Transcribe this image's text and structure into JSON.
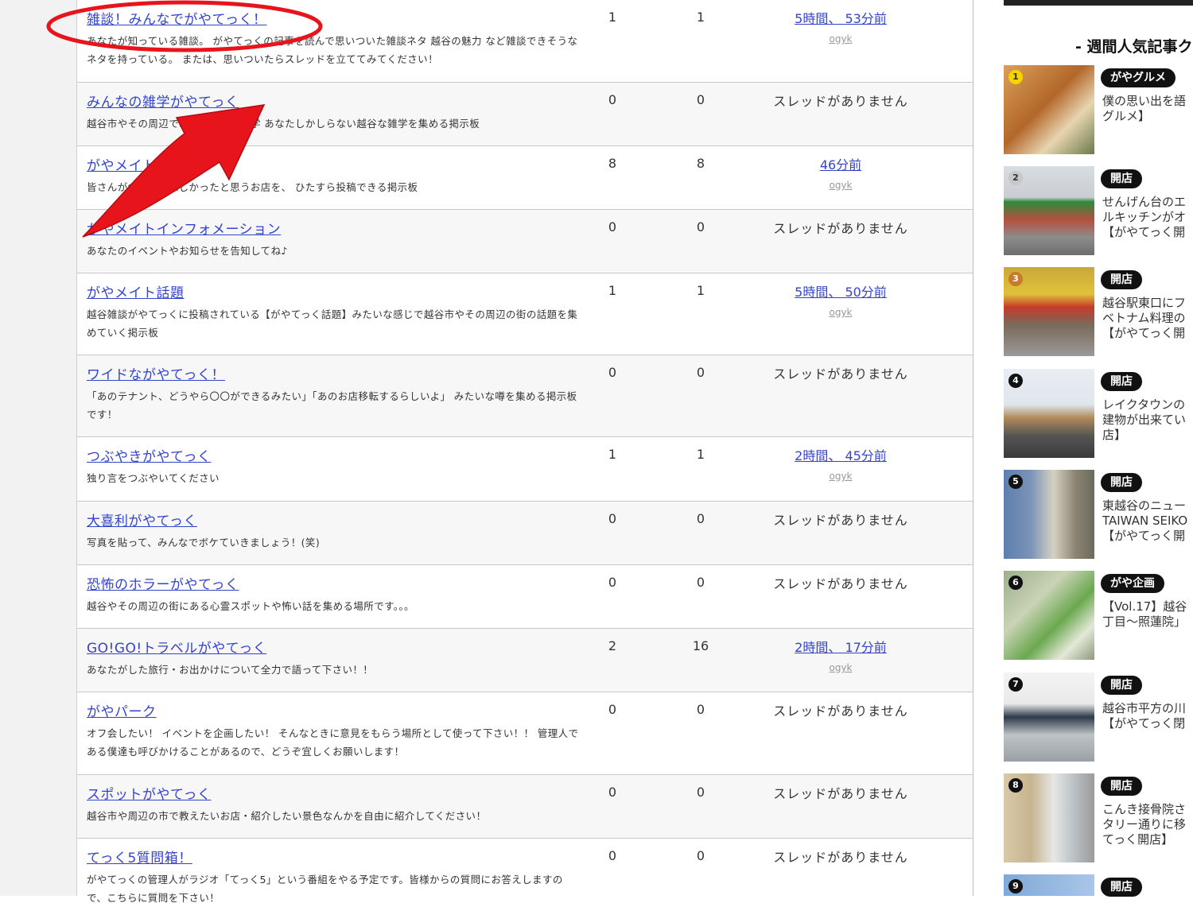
{
  "boards": [
    {
      "title": "雑談！みんなでがやてっく！",
      "desc": "あなたが知っている雑談。 がやてっくの記事を読んで思いついた雑談ネタ 越谷の魅力 など雑談できそうなネタを持っている。 または、思いついたらスレッドを立ててみてください！",
      "threads": "1",
      "posts": "1",
      "last_time": "5時間、 53分前",
      "last_user": "ogyk",
      "no_thread": ""
    },
    {
      "title": "みんなの雑学がやてっく",
      "desc": "越谷市やその周辺で囁かれている雑学 あなたしかしらない越谷な雑学を集める掲示板",
      "threads": "0",
      "posts": "0",
      "last_time": "",
      "last_user": "",
      "no_thread": "スレッドがありません"
    },
    {
      "title": "がやメイトグルメ",
      "desc": "皆さんが食べて美味しかったと思うお店を、 ひたすら投稿できる掲示板",
      "threads": "8",
      "posts": "8",
      "last_time": "46分前",
      "last_user": "ogyk",
      "no_thread": ""
    },
    {
      "title": "がやメイトインフォメーション",
      "desc": "あなたのイベントやお知らせを告知してね♪",
      "threads": "0",
      "posts": "0",
      "last_time": "",
      "last_user": "",
      "no_thread": "スレッドがありません"
    },
    {
      "title": "がやメイト話題",
      "desc": "越谷雑談がやてっくに投稿されている【がやてっく話題】みたいな感じで越谷市やその周辺の街の話題を集めていく掲示板",
      "threads": "1",
      "posts": "1",
      "last_time": "5時間、 50分前",
      "last_user": "ogyk",
      "no_thread": ""
    },
    {
      "title": "ワイドながやてっく！",
      "desc": "「あのテナント、どうやら〇〇ができるみたい」「あのお店移転するらしいよ」 みたいな噂を集める掲示板です！",
      "threads": "0",
      "posts": "0",
      "last_time": "",
      "last_user": "",
      "no_thread": "スレッドがありません"
    },
    {
      "title": "つぶやきがやてっく",
      "desc": "独り言をつぶやいてください",
      "threads": "1",
      "posts": "1",
      "last_time": "2時間、 45分前",
      "last_user": "ogyk",
      "no_thread": ""
    },
    {
      "title": "大喜利がやてっく",
      "desc": "写真を貼って、みんなでボケていきましょう！(笑)",
      "threads": "0",
      "posts": "0",
      "last_time": "",
      "last_user": "",
      "no_thread": "スレッドがありません"
    },
    {
      "title": "恐怖のホラーがやてっく",
      "desc": "越谷やその周辺の街にある心霊スポットや怖い話を集める場所です。。。",
      "threads": "0",
      "posts": "0",
      "last_time": "",
      "last_user": "",
      "no_thread": "スレッドがありません"
    },
    {
      "title": "GO!GO!トラベルがやてっく",
      "desc": "あなたがした旅行・お出かけについて全力で語って下さい！！",
      "threads": "2",
      "posts": "16",
      "last_time": "2時間、 17分前",
      "last_user": "ogyk",
      "no_thread": ""
    },
    {
      "title": "がやパーク",
      "desc": "オフ会したい！ イベントを企画したい！ そんなときに意見をもらう場所として使って下さい！！ 管理人である僕達も呼びかけることがあるので、どうぞ宜しくお願いします！",
      "threads": "0",
      "posts": "0",
      "last_time": "",
      "last_user": "",
      "no_thread": "スレッドがありません"
    },
    {
      "title": "スポットがやてっく",
      "desc": "越谷市や周辺の市で教えたいお店・紹介したい景色なんかを自由に紹介してください！",
      "threads": "0",
      "posts": "0",
      "last_time": "",
      "last_user": "",
      "no_thread": "スレッドがありません"
    },
    {
      "title": "てっく5質問箱！",
      "desc": "がやてっくの管理人がラジオ「てっく5」という番組をやる予定です。皆様からの質問にお答えしますので、こちらに質問を下さい！",
      "threads": "0",
      "posts": "0",
      "last_time": "",
      "last_user": "",
      "no_thread": "スレッドがありません"
    }
  ],
  "sidebar": {
    "heading": "- 週間人気記事ク",
    "items": [
      {
        "rank": "1",
        "category": "がやグルメ",
        "title": "僕の思い出を語\nグルメ】"
      },
      {
        "rank": "2",
        "category": "開店",
        "title": "せんげん台のエ\nルキッチンがオ\n【がやてっく開"
      },
      {
        "rank": "3",
        "category": "開店",
        "title": "越谷駅東口にフ\nベトナム料理の\n【がやてっく開"
      },
      {
        "rank": "4",
        "category": "開店",
        "title": "レイクタウンの\n建物が出来てい\n店】"
      },
      {
        "rank": "5",
        "category": "開店",
        "title": "東越谷のニュー\nTAIWAN SEIKO\n【がやてっく開"
      },
      {
        "rank": "6",
        "category": "がや企画",
        "title": "【Vol.17】越谷\n丁目～照蓮院」"
      },
      {
        "rank": "7",
        "category": "開店",
        "title": "越谷市平方の川\n【がやてっく閉"
      },
      {
        "rank": "8",
        "category": "開店",
        "title": "こんき接骨院さ\nタリー通りに移\nてっく開店】"
      },
      {
        "rank": "9",
        "category": "開店",
        "title": ""
      }
    ]
  },
  "colors": {
    "link": "#3344cc",
    "annotation_red": "#e8141c",
    "pill_bg": "#111111"
  }
}
